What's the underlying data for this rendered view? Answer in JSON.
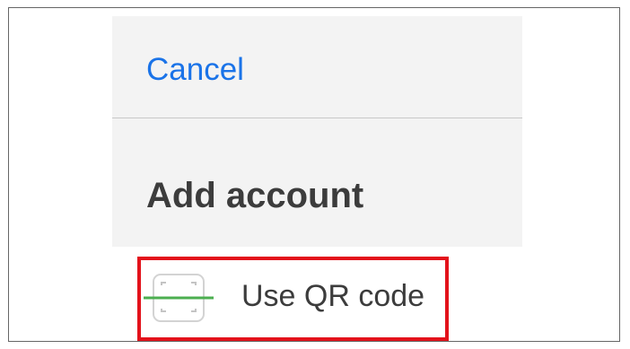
{
  "dialog": {
    "cancel_label": "Cancel",
    "title": "Add account"
  },
  "options": {
    "qr": {
      "label": "Use QR code",
      "icon": "qr-scan-icon",
      "highlight_color": "#e3121b",
      "scan_line_color": "#4caf50"
    }
  },
  "colors": {
    "link": "#1a73e8",
    "panel_background": "#f3f3f3"
  }
}
